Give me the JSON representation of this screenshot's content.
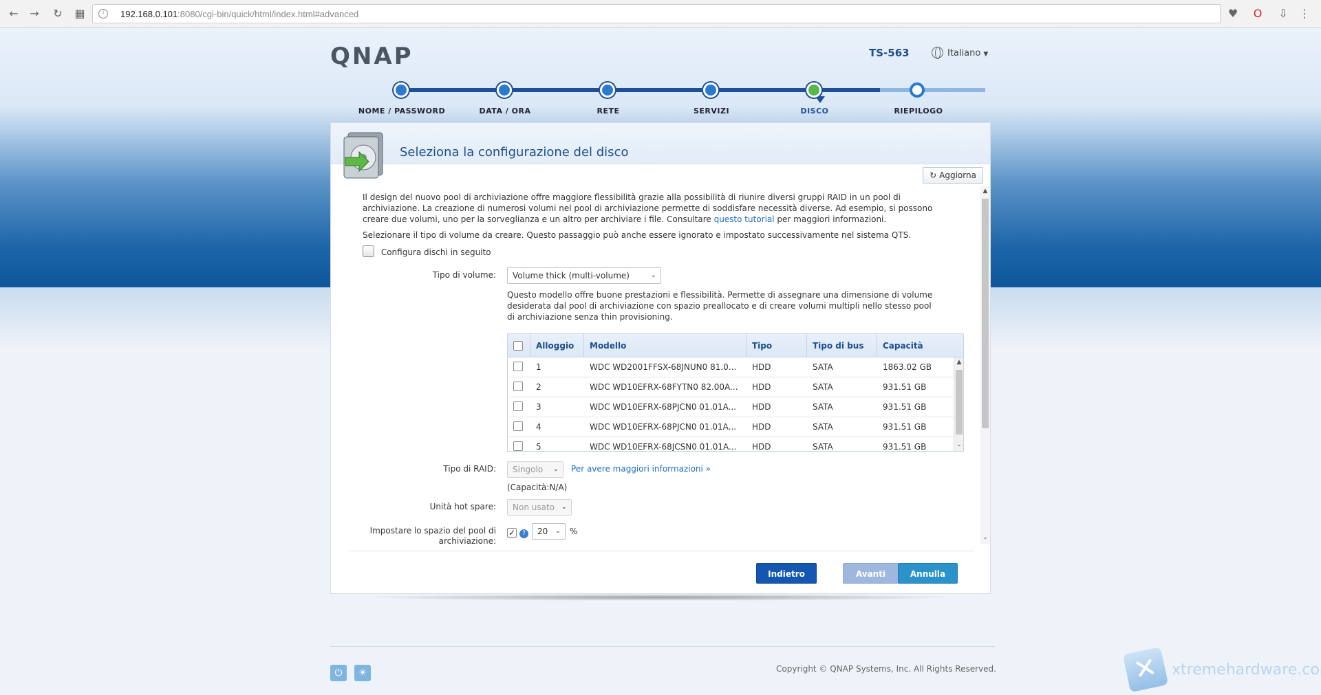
{
  "browser": {
    "url_host": "192.168.0.101",
    "url_path": ":8080/cgi-bin/quick/html/index.html#advanced"
  },
  "header": {
    "logo": "QNAP",
    "model": "TS-563",
    "language": "Italiano"
  },
  "steps": [
    {
      "label": "NOME / PASSWORD",
      "state": "done"
    },
    {
      "label": "DATA / ORA",
      "state": "done"
    },
    {
      "label": "RETE",
      "state": "done"
    },
    {
      "label": "SERVIZI",
      "state": "done"
    },
    {
      "label": "DISCO",
      "state": "active"
    },
    {
      "label": "RIEPILOGO",
      "state": "todo"
    }
  ],
  "panel": {
    "title": "Seleziona la configurazione del disco",
    "refresh_label": "Aggiorna",
    "intro_before_link": "Il design del nuovo pool di archiviazione offre maggiore flessibilità grazie alla possibilità di riunire diversi gruppi RAID in un pool di archiviazione. La creazione di numerosi volumi nel pool di archiviazione permette di soddisfare necessità diverse. Ad esempio, si possono creare due volumi, uno per la sorveglianza e un altro per archiviare i file. Consultare ",
    "intro_link": "questo tutorial",
    "intro_after_link": " per maggiori informazioni.",
    "select_type_text": "Selezionare il tipo di volume da creare. Questo passaggio può anche essere ignorato e impostato successivamente nel sistema QTS.",
    "configure_later_label": "Configura dischi in seguito",
    "volume_type_label": "Tipo di volume:",
    "volume_type_value": "Volume thick (multi-volume)",
    "volume_description": "Questo modello offre buone prestazioni e flessibilità. Permette di assegnare una dimensione di volume desiderata dal pool di archiviazione con spazio preallocato e di creare volumi multipli nello stesso pool di archiviazione senza thin provisioning.",
    "table": {
      "headers": [
        "Alloggio",
        "Modello",
        "Tipo",
        "Tipo di bus",
        "Capacità"
      ],
      "rows": [
        {
          "bay": "1",
          "model": "WDC WD2001FFSX-68JNUN0 81.0...",
          "type": "HDD",
          "bus": "SATA",
          "capacity": "1863.02 GB"
        },
        {
          "bay": "2",
          "model": "WDC WD10EFRX-68FYTN0 82.00A...",
          "type": "HDD",
          "bus": "SATA",
          "capacity": "931.51 GB"
        },
        {
          "bay": "3",
          "model": "WDC WD10EFRX-68PJCN0 01.01A...",
          "type": "HDD",
          "bus": "SATA",
          "capacity": "931.51 GB"
        },
        {
          "bay": "4",
          "model": "WDC WD10EFRX-68PJCN0 01.01A...",
          "type": "HDD",
          "bus": "SATA",
          "capacity": "931.51 GB"
        },
        {
          "bay": "5",
          "model": "WDC WD10EFRX-68JCSN0 01.01A...",
          "type": "HDD",
          "bus": "SATA",
          "capacity": "931.51 GB"
        }
      ]
    },
    "raid_label": "Tipo di RAID:",
    "raid_value": "Singolo",
    "raid_info_link": "Per avere maggiori informazioni »",
    "capacity_text": "(Capacità:N/A)",
    "hot_spare_label": "Unità hot spare:",
    "hot_spare_value": "Non usato",
    "pool_space_label": "Impostare lo spazio del pool di archiviazione:",
    "pool_space_value": "20",
    "pool_space_unit": "%",
    "back_label": "Indietro",
    "next_label": "Avanti",
    "cancel_label": "Annulla"
  },
  "footer": {
    "copyright": "Copyright © QNAP Systems, Inc. All Rights Reserved.",
    "watermark": "xtremehardware.com"
  },
  "colors": {
    "accent": "#1f4f98",
    "active_step": "#55b948",
    "cancel": "#2b93c9"
  }
}
